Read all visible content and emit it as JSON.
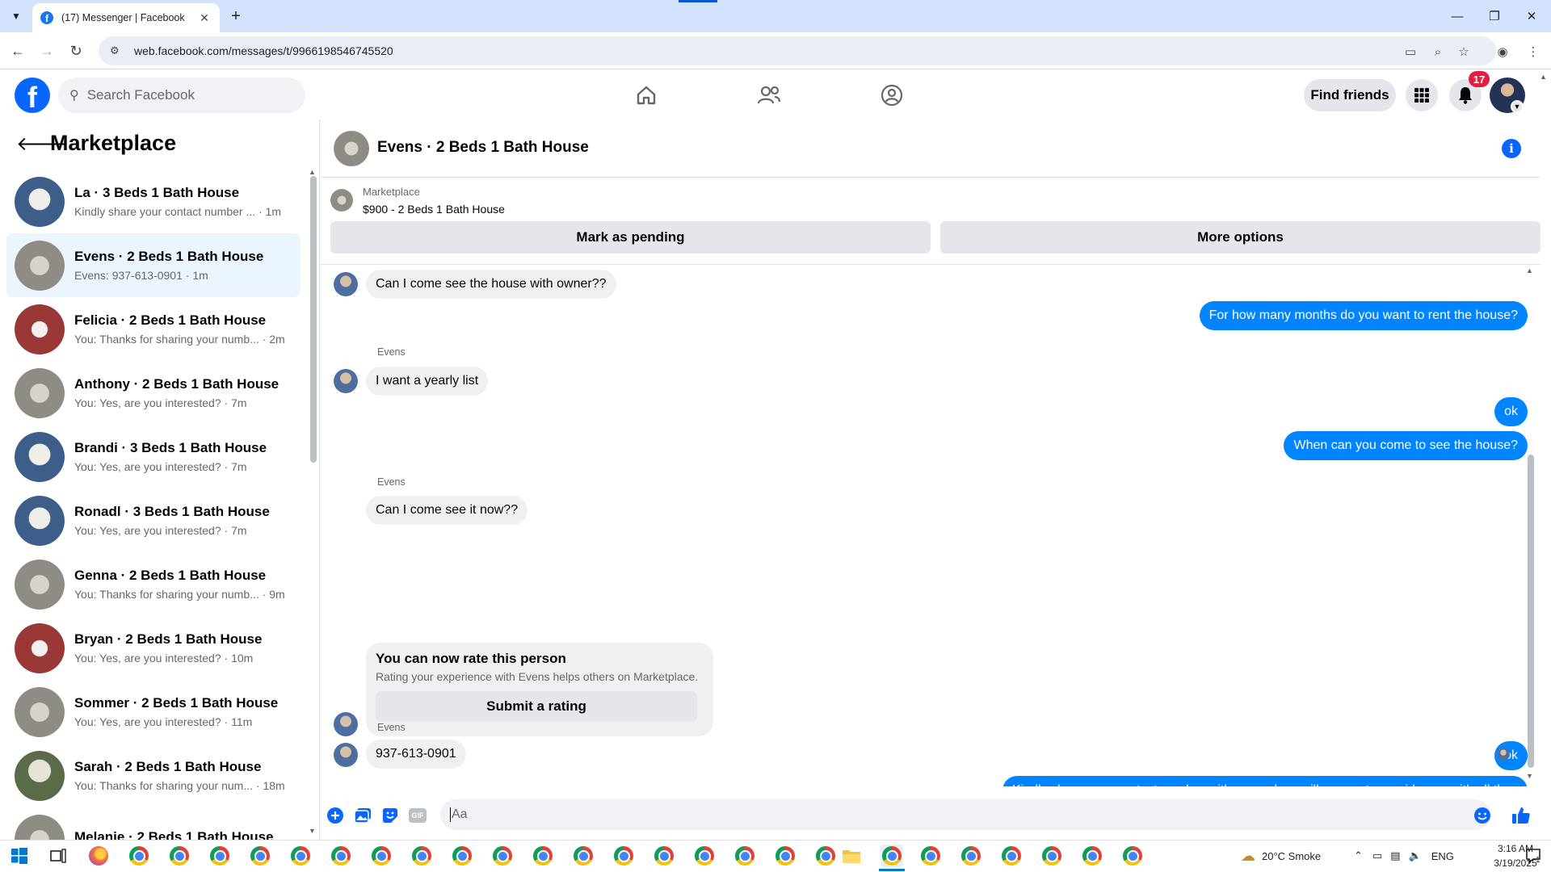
{
  "browser": {
    "tab_title": "(17) Messenger | Facebook",
    "tab_close": "✕",
    "new_tab": "+",
    "url": "web.facebook.com/messages/t/9966198546745520"
  },
  "fb": {
    "search_placeholder": "Search Facebook",
    "find_friends": "Find friends",
    "notification_count": "17"
  },
  "sidebar": {
    "title": "Marketplace",
    "conversations": [
      {
        "name": "La · 3 Beds 1 Bath House",
        "preview": "Kindly share your contact number ... · 1m"
      },
      {
        "name": "Evens · 2 Beds 1 Bath House",
        "preview": "Evens: 937-613-0901 · 1m"
      },
      {
        "name": "Felicia · 2 Beds 1 Bath House",
        "preview": "You: Thanks for sharing your numb... · 2m"
      },
      {
        "name": "Anthony · 2 Beds 1 Bath House",
        "preview": "You: Yes, are you interested? · 7m"
      },
      {
        "name": "Brandi · 3 Beds 1 Bath House",
        "preview": "You: Yes, are you interested? · 7m"
      },
      {
        "name": "Ronadl · 3 Beds 1 Bath House",
        "preview": "You: Yes, are you interested? · 7m"
      },
      {
        "name": "Genna · 2 Beds 1 Bath House",
        "preview": "You: Thanks for sharing your numb... · 9m"
      },
      {
        "name": "Bryan · 2 Beds 1 Bath House",
        "preview": "You: Yes, are you interested? · 10m"
      },
      {
        "name": "Sommer · 2 Beds 1 Bath House",
        "preview": "You: Yes, are you interested? · 11m"
      },
      {
        "name": "Sarah · 2 Beds 1 Bath House",
        "preview": "You: Thanks for sharing your num... · 18m"
      },
      {
        "name": "Melanie · 2 Beds 1 Bath House",
        "preview": ""
      }
    ]
  },
  "chat": {
    "title": "Evens · 2 Beds 1 Bath House",
    "listing_label": "Marketplace",
    "listing_title": "$900 - 2 Beds 1 Bath House",
    "mark_pending": "Mark as pending",
    "more_options": "More options",
    "sender_name": "Evens",
    "messages": {
      "m1": "Can I come see the house with owner??",
      "m2": "For how many months do you want to rent the house?",
      "m3": "I want a yearly list",
      "m4": "ok",
      "m5": "When can you come to see the house?",
      "m6": "Can I come see it now??",
      "m7": "ok",
      "m8": "Kindly share your contact number with us, and we will ensure to provide you with all the necessary information directly on your number.",
      "m9": "937-613-0901"
    },
    "rating": {
      "title": "You can now rate this person",
      "desc": "Rating your experience with Evens helps others on Marketplace.",
      "button": "Submit a rating"
    },
    "composer_placeholder": "Aa",
    "gif_label": "GIF"
  },
  "taskbar": {
    "weather": "20°C  Smoke",
    "lang": "ENG",
    "time": "3:16 AM",
    "date": "3/19/2025",
    "notif": "1"
  }
}
